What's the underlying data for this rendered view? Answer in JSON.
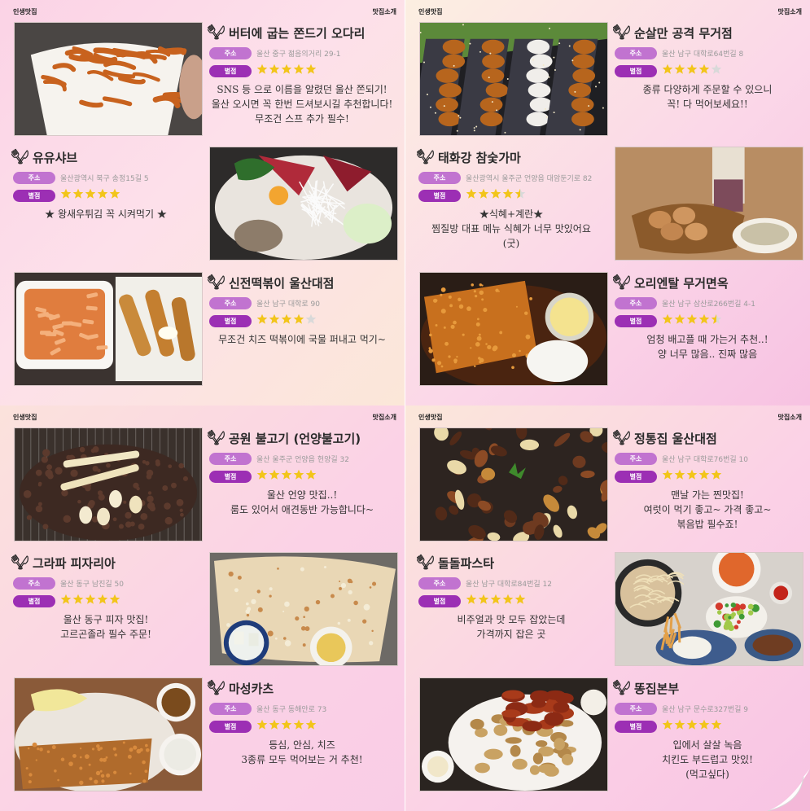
{
  "labels": {
    "address": "주소",
    "rating": "별점"
  },
  "pages": [
    {
      "brand": "인생맛집",
      "menu": "맛집소개",
      "entries": [
        {
          "name": "버터에 굽는 쫀드기 오다리",
          "address": "울산 중구 젊음의거리 29-1",
          "rating": 5,
          "description": "SNS 등 으로 이름을 알렸던 울산 쫀되기!\n울산 오시면 꼭 한번 드셔보시길 추천합니다!\n무조건 스프 추가 필수!",
          "photo": "squid-snack-cup"
        },
        {
          "name": "유유샤브",
          "address": "울산광역시 북구 송정15길 5",
          "rating": 5,
          "description": "★ 왕새우튀김 꼭 시켜먹기 ★",
          "photo": "shabu-platter"
        },
        {
          "name": "신전떡볶이 울산대점",
          "address": "울산 남구 대학로 90",
          "rating": 4,
          "description": "무조건 치즈 떡볶이에 국물 퍼내고 먹기~",
          "photo": "tteokbokki"
        }
      ]
    },
    {
      "brand": "인생맛집",
      "menu": "맛집소개",
      "entries": [
        {
          "name": "순살만 공격 무거점",
          "address": "울산 남구 대학로64번길 8",
          "rating": 4,
          "description": "종류 다양하게 주문할 수 있으니\n꼭! 다 먹어보세요!!",
          "photo": "boneless-chicken"
        },
        {
          "name": "태화강 참숯가마",
          "address": "울산광역시 울주군 언양읍 대암둔기로 82",
          "rating": 4.5,
          "description": "★식혜+계란★\n찜질방 대표 메뉴 식혜가 너무 맛있어요\n(굿)",
          "photo": "sikhye-eggs"
        },
        {
          "name": "오리엔탈 무거면옥",
          "address": "울산 남구 삼산로266번길 4-1",
          "rating": 4.5,
          "description": "엄청 배고플 때 가는거 추천..!\n양 너무 많음.. 진짜 많음",
          "photo": "pork-cutlet"
        }
      ]
    },
    {
      "brand": "인생맛집",
      "menu": "맛집소개",
      "entries": [
        {
          "name": "공원 불고기 (언양불고기)",
          "address": "울산 울주군 언양읍 헌양길 32",
          "rating": 5,
          "description": "울산 언양 맛집..!\n룸도 있어서 애견동반 가능합니다~",
          "photo": "bulgogi-grill"
        },
        {
          "name": "그라파 피자리아",
          "address": "울산 동구 남진길 50",
          "rating": 5,
          "description": "울산 동구 피자 맛집!\n고르곤졸라 필수 주문!",
          "photo": "pizza"
        },
        {
          "name": "마성카츠",
          "address": "울산 동구 동해안로 73",
          "rating": 5,
          "description": "등심, 안심, 치즈\n3종류 모두 먹어보는 거 추천!",
          "photo": "katsu-set"
        }
      ]
    },
    {
      "brand": "인생맛집",
      "menu": "맛집소개",
      "entries": [
        {
          "name": "정통집 울산대점",
          "address": "울산 남구 대학로76번길 10",
          "rating": 5,
          "description": "맨날 가는 찐맛집!\n여럿이 먹기 좋고~ 가격 좋고~\n볶음밥 필수죠!",
          "photo": "spicy-pork"
        },
        {
          "name": "돌돌파스타",
          "address": "울산 남구 대학로84번길 12",
          "rating": 5,
          "description": "비주얼과 맛 모두 잡았는데\n가격까지 잡은 곳",
          "photo": "pasta-table"
        },
        {
          "name": "똥집본부",
          "address": "울산 남구 문수로327번길 9",
          "rating": 5,
          "description": "입에서 살살 녹음\n치킨도 부드럽고 맛있!\n(먹고싶다)",
          "photo": "fried-gizzards"
        }
      ]
    }
  ],
  "colors": {
    "address_pill": "#c173d0",
    "rating_pill": "#9c2fb4",
    "star_on": "#f2c51a",
    "star_off": "#d9d9d9"
  }
}
